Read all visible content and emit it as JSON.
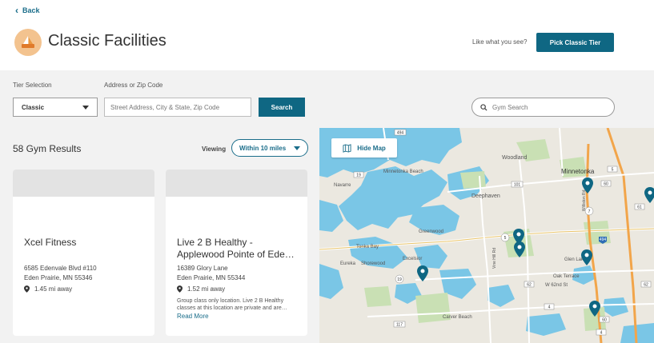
{
  "header": {
    "back_label": "Back",
    "title": "Classic Facilities",
    "like_text": "Like what you see?",
    "pick_button": "Pick Classic Tier"
  },
  "filters": {
    "tier_label": "Tier Selection",
    "tier_value": "Classic",
    "address_label": "Address or Zip Code",
    "address_placeholder": "Street Address, City & State, Zip Code",
    "search_button": "Search",
    "gym_search_placeholder": "Gym Search"
  },
  "results": {
    "count_text": "58 Gym Results",
    "viewing_label": "Viewing",
    "radius_value": "Within 10 miles"
  },
  "cards": [
    {
      "name": "Xcel Fitness",
      "address_line1": "6585 Edenvale Blvd #110",
      "address_line2": "Eden Prairie, MN 55346",
      "distance": "1.45 mi away"
    },
    {
      "name": "Live 2 B Healthy - Applewood Pointe of Ede…",
      "address_line1": "16389 Glory Lane",
      "address_line2": "Eden Prairie, MN 55344",
      "distance": "1.52 mi away",
      "description": "Group class only location. Live 2 B Healthy classes at this location are private and are…",
      "read_more": "Read More"
    }
  ],
  "map": {
    "hide_label": "Hide Map",
    "places": [
      "Woodland",
      "Minnetonka",
      "Minnetonka Beach",
      "Navarre",
      "Deephaven",
      "Greenwood",
      "Tonka Bay",
      "Excelsior",
      "Eureka",
      "Shorewood",
      "Glen Lake",
      "Oak Terrace",
      "Carver Beach",
      "W 62nd St",
      "Vine Hill Rd",
      "Williston Rd"
    ],
    "shields": [
      "494",
      "19",
      "101",
      "7",
      "60",
      "5",
      "61",
      "494",
      "62",
      "62",
      "4",
      "5",
      "117",
      "60",
      "19",
      "4"
    ]
  },
  "colors": {
    "accent": "#0f6783",
    "water": "#7ac6e6",
    "land": "#ebe8e0",
    "park": "#c9e0b4"
  }
}
